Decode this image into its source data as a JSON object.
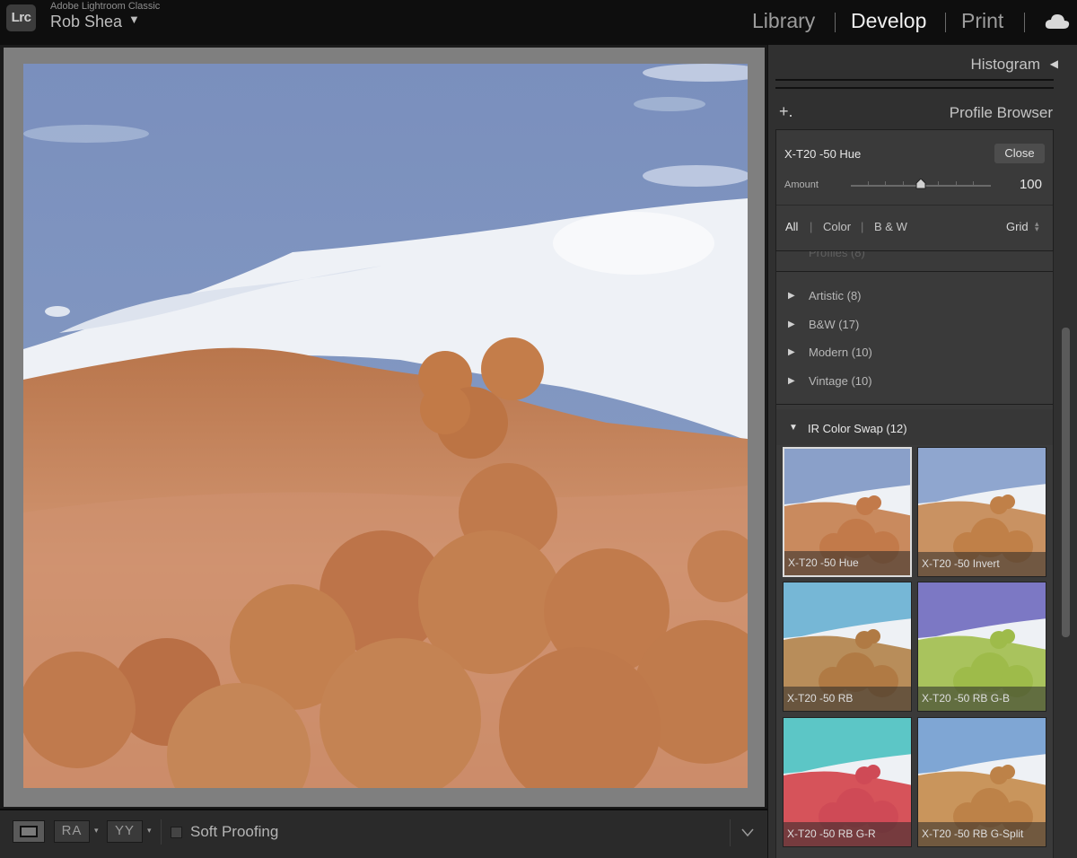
{
  "app": {
    "logo_text": "Lrc",
    "app_name": "Adobe Lightroom Classic",
    "user_name": "Rob Shea",
    "user_caret": "▼"
  },
  "modules": {
    "library": "Library",
    "develop": "Develop",
    "print": "Print",
    "separator": "|",
    "active": "Develop",
    "cloud_icon": "cloud-icon"
  },
  "toolbar": {
    "view_icon": "loupe-view-icon",
    "before_after_ra": "RA",
    "before_after_yy": "YY",
    "caret": "▾",
    "soft_proofing_label": "Soft Proofing",
    "soft_proofing_checked": false
  },
  "panels": {
    "histogram_title": "Histogram",
    "histogram_arrow": "◀",
    "profile_browser_title": "Profile Browser",
    "add_icon": "+."
  },
  "profile_browser": {
    "selected_profile": "X-T20 -50 Hue",
    "close_label": "Close",
    "amount_label": "Amount",
    "amount_value": "100",
    "amount_fraction": 0.5,
    "filters": [
      "All",
      "Color",
      "B & W"
    ],
    "filter_separator": "|",
    "active_filter": "All",
    "view_mode": "Grid",
    "view_mode_caret": "◆",
    "faded_row": "Profiles (8)",
    "groups": [
      {
        "label": "Artistic (8)",
        "arrow": "▶"
      },
      {
        "label": "B&W (17)",
        "arrow": "▶"
      },
      {
        "label": "Modern (10)",
        "arrow": "▶"
      },
      {
        "label": "Vintage (10)",
        "arrow": "▶"
      }
    ],
    "open_group": {
      "label": "IR Color Swap (12)",
      "arrow": "▼"
    },
    "thumbnails": [
      {
        "label": "X-T20 -50 Hue",
        "sky": "#8aa0c9",
        "land": "#c98a5e",
        "trees": "#c27a4a",
        "selected": true
      },
      {
        "label": "X-T20 -50 Invert",
        "sky": "#8fa6cf",
        "land": "#c99262",
        "trees": "#c08048",
        "selected": false
      },
      {
        "label": "X-T20 -50 RB",
        "sky": "#76b7d6",
        "land": "#b88d5a",
        "trees": "#b07a44",
        "selected": false
      },
      {
        "label": "X-T20 -50 RB G-B",
        "sky": "#7c78c4",
        "land": "#a9c35d",
        "trees": "#9ebb4a",
        "selected": false
      },
      {
        "label": "X-T20 -50 RB G-R",
        "sky": "#5cc6c6",
        "land": "#d6535a",
        "trees": "#cf4a56",
        "selected": false
      },
      {
        "label": "X-T20 -50 RB G-Split",
        "sky": "#7fa6d4",
        "land": "#c9955c",
        "trees": "#bd8248",
        "selected": false
      }
    ]
  },
  "colors": {
    "sky": "#7f95c0",
    "land": "#c8865f",
    "trees": "#c17a4e",
    "cloud": "#f2f3f5"
  }
}
